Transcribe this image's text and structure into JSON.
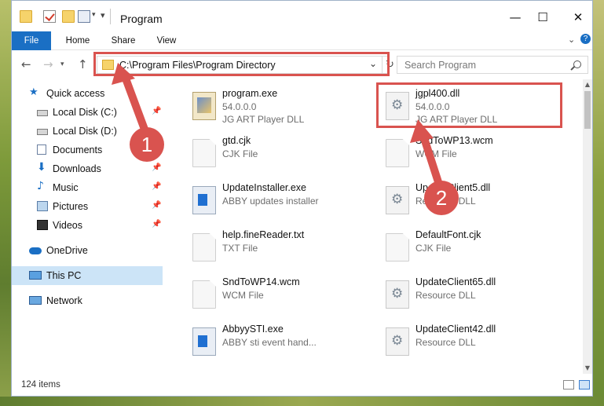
{
  "window": {
    "title": "Program"
  },
  "ribbon": {
    "tabs": [
      "File",
      "Home",
      "Share",
      "View"
    ]
  },
  "address": {
    "path": "C:\\Program Files\\Program Directory"
  },
  "search": {
    "placeholder": "Search Program"
  },
  "navpane": {
    "items": [
      {
        "label": "Quick access",
        "icon": "star-icon"
      },
      {
        "label": "Local Disk (C:)",
        "icon": "drive-icon"
      },
      {
        "label": "Local Disk (D:)",
        "icon": "drive-icon"
      },
      {
        "label": "Documents",
        "icon": "documents-icon"
      },
      {
        "label": "Downloads",
        "icon": "download-icon"
      },
      {
        "label": "Music",
        "icon": "music-icon"
      },
      {
        "label": "Pictures",
        "icon": "pictures-icon"
      },
      {
        "label": "Videos",
        "icon": "videos-icon"
      },
      {
        "label": "OneDrive",
        "icon": "cloud-icon"
      },
      {
        "label": "This PC",
        "icon": "computer-icon",
        "selected": true
      },
      {
        "label": "Network",
        "icon": "network-icon"
      }
    ]
  },
  "files": [
    {
      "name": "program.exe",
      "line1": "54.0.0.0",
      "line2": "JG ART Player DLL"
    },
    {
      "name": "jgpl400.dll",
      "line1": "54.0.0.0",
      "line2": "JG ART Player DLL"
    },
    {
      "name": "gtd.cjk",
      "line1": "CJK File",
      "line2": ""
    },
    {
      "name": "SndToWP13.wcm",
      "line1": "WCM File",
      "line2": ""
    },
    {
      "name": "UpdateInstaller.exe",
      "line1": "ABBY updates installer",
      "line2": ""
    },
    {
      "name": "UpdateClient5.dll",
      "line1": "Resource DLL",
      "line2": ""
    },
    {
      "name": "help.fineReader.txt",
      "line1": "TXT File",
      "line2": ""
    },
    {
      "name": "DefaultFont.cjk",
      "line1": "CJK File",
      "line2": ""
    },
    {
      "name": "SndToWP14.wcm",
      "line1": "WCM File",
      "line2": ""
    },
    {
      "name": "UpdateClient65.dll",
      "line1": "Resource DLL",
      "line2": ""
    },
    {
      "name": "AbbyySTI.exe",
      "line1": "ABBY sti event hand...",
      "line2": ""
    },
    {
      "name": "UpdateClient42.dll",
      "line1": "Resource DLL",
      "line2": ""
    }
  ],
  "status": {
    "count": "124 items"
  },
  "annotations": {
    "step1": "1",
    "step2": "2",
    "color": "#d9534f"
  }
}
